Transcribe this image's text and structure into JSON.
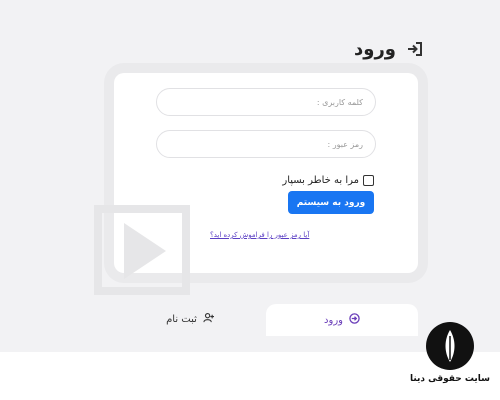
{
  "header": {
    "title": "ورود",
    "icon": "login-icon"
  },
  "form": {
    "username_placeholder": "کلمه کاربری :",
    "password_placeholder": "رمز عبور :",
    "remember_label": "مرا به خاطر بسپار",
    "submit_label": "ورود به سیستم",
    "forgot_link": "آیا رمز عبور را فراموش کرده اید؟"
  },
  "tabs": [
    {
      "label": "ورود",
      "icon": "login-circle-icon",
      "active": true
    },
    {
      "label": "ثبت نام",
      "icon": "add-user-icon",
      "active": false
    }
  ],
  "brand": {
    "name": "سایت حقوقی دینا",
    "icon": "quill-pen-icon"
  },
  "colors": {
    "primary": "#1976f2",
    "accent": "#6a3db9",
    "background": "#f2f2f4"
  }
}
